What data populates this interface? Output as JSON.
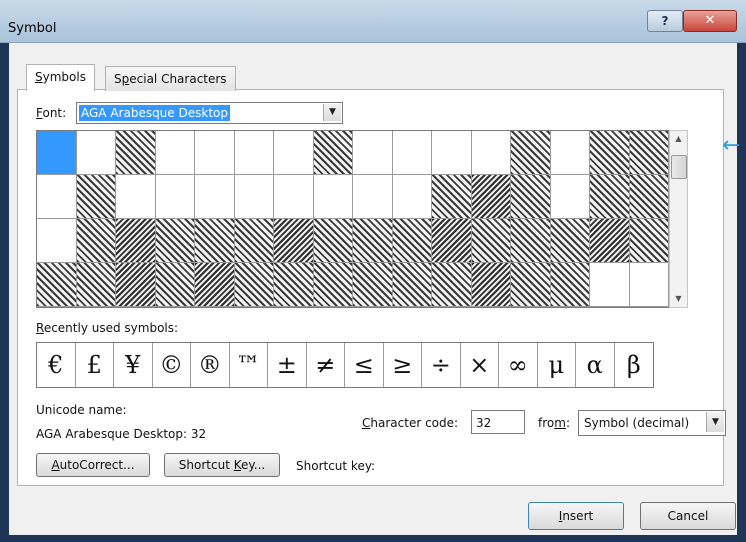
{
  "window": {
    "title": "Symbol",
    "help_label": "?",
    "close_label": "✕"
  },
  "tabs": [
    {
      "label_u": "S",
      "label_rest": "ymbols"
    },
    {
      "label_pre": "S",
      "label_u": "p",
      "label_rest": "ecial Characters"
    }
  ],
  "font": {
    "label_u": "F",
    "label_rest": "ont:",
    "value": "AGA Arabesque Desktop"
  },
  "recent": {
    "label_u": "R",
    "label_rest": "ecently used symbols:",
    "symbols": [
      "€",
      "£",
      "¥",
      "©",
      "®",
      "™",
      "±",
      "≠",
      "≤",
      "≥",
      "÷",
      "×",
      "∞",
      "μ",
      "α",
      "β"
    ]
  },
  "unicode": {
    "label": "Unicode name:",
    "value": "AGA Arabesque Desktop: 32"
  },
  "charcode": {
    "label_u": "C",
    "label_rest": "haracter code:",
    "value": "32"
  },
  "from": {
    "label_pre": "fro",
    "label_u": "m",
    "label_rest": ":",
    "value": "Symbol (decimal)"
  },
  "buttons": {
    "autocorrect_u": "A",
    "autocorrect_rest": "utoCorrect...",
    "shortcut_pre": "Shortcut ",
    "shortcut_u": "K",
    "shortcut_rest": "ey...",
    "insert_u": "I",
    "insert_rest": "nsert",
    "cancel": "Cancel"
  },
  "shortcut_key_label": "Shortcut key:",
  "colors": {
    "selection": "#3399ff",
    "titlebar": "#b8cfe3",
    "close": "#c8453a"
  }
}
